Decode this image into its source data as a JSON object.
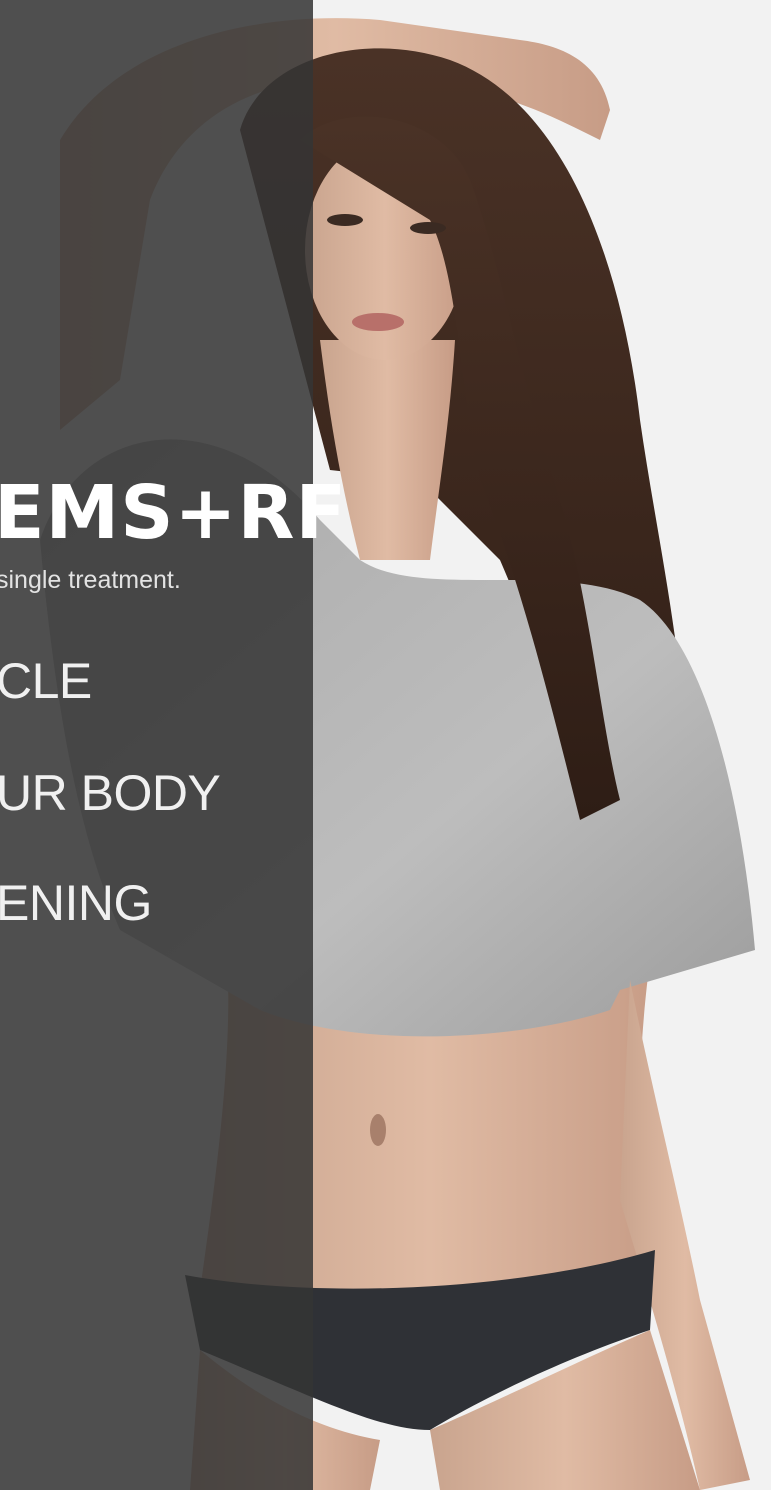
{
  "banner": {
    "headline": "EMS+RF",
    "tagline": "single treatment.",
    "features": [
      "CLE",
      "UR BODY",
      "ENING"
    ],
    "colors": {
      "overlay": "#343434",
      "headline": "#ffffff",
      "background": "#f2f2f2"
    }
  },
  "photo": {
    "subject": "model-photo",
    "icon": "model-photo-icon"
  }
}
